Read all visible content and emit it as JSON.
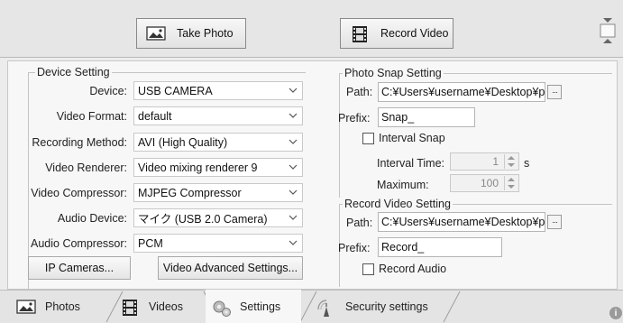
{
  "toolbar": {
    "take_photo": "Take Photo",
    "record_video": "Record Video"
  },
  "device_setting": {
    "title": "Device Setting",
    "rows": [
      {
        "label": "Device:",
        "value": "USB CAMERA"
      },
      {
        "label": "Video Format:",
        "value": "default"
      },
      {
        "label": "Recording Method:",
        "value": "AVI (High Quality)"
      },
      {
        "label": "Video Renderer:",
        "value": "Video mixing renderer 9"
      },
      {
        "label": "Video Compressor:",
        "value": "MJPEG Compressor"
      },
      {
        "label": "Audio Device:",
        "value": "マイク (USB 2.0 Camera)"
      },
      {
        "label": "Audio Compressor:",
        "value": "PCM"
      }
    ],
    "ip_cameras_button": "IP Cameras...",
    "advanced_button": "Video Advanced Settings..."
  },
  "photo_snap": {
    "title": "Photo Snap Setting",
    "path_label": "Path:",
    "path_value": "C:¥Users¥username¥Desktop¥ph",
    "browse": "···",
    "prefix_label": "Prefix:",
    "prefix_value": "Snap_",
    "interval_snap_label": "Interval Snap",
    "interval_snap_checked": false,
    "interval_time_label": "Interval Time:",
    "interval_time_value": "1",
    "interval_unit": "s",
    "maximum_label": "Maximum:",
    "maximum_value": "100"
  },
  "record_video": {
    "title": "Record Video Setting",
    "path_label": "Path:",
    "path_value": "C:¥Users¥username¥Desktop¥ph",
    "browse": "···",
    "prefix_label": "Prefix:",
    "prefix_value": "Record_",
    "record_audio_label": "Record Audio",
    "record_audio_checked": false
  },
  "tabs": [
    {
      "label": "Photos",
      "icon": "photo-icon",
      "active": false
    },
    {
      "label": "Videos",
      "icon": "film-icon",
      "active": false
    },
    {
      "label": "Settings",
      "icon": "gears-icon",
      "active": true
    },
    {
      "label": "Security settings",
      "icon": "security-icon",
      "active": false
    }
  ],
  "info_glyph": "i"
}
